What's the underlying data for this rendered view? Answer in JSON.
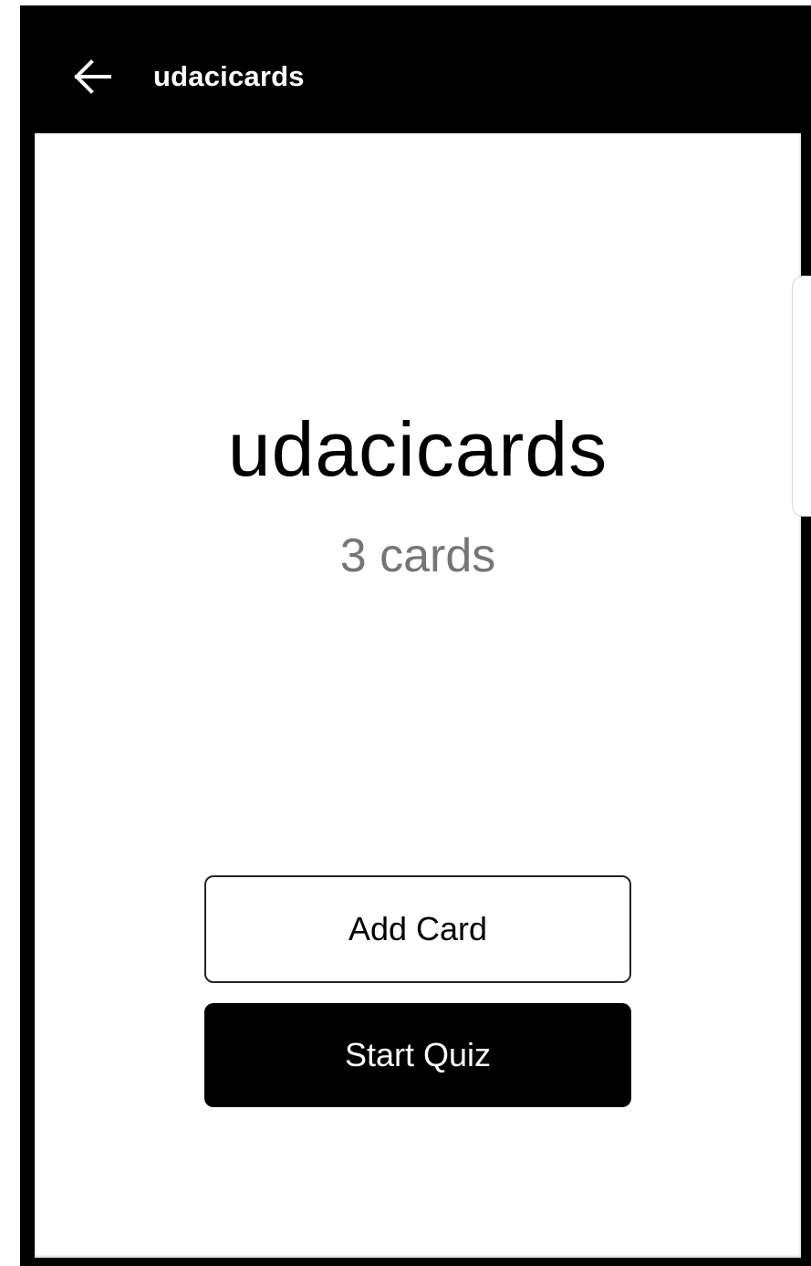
{
  "header": {
    "title": "udacicards",
    "back_icon": "arrow-left-icon"
  },
  "deck": {
    "title": "udacicards",
    "card_count": "3 cards"
  },
  "actions": {
    "add_card_label": "Add Card",
    "start_quiz_label": "Start Quiz"
  },
  "colors": {
    "header_bg": "#000000",
    "header_text": "#ffffff",
    "subtitle": "#757575",
    "primary_button_bg": "#000000",
    "primary_button_text": "#ffffff"
  }
}
